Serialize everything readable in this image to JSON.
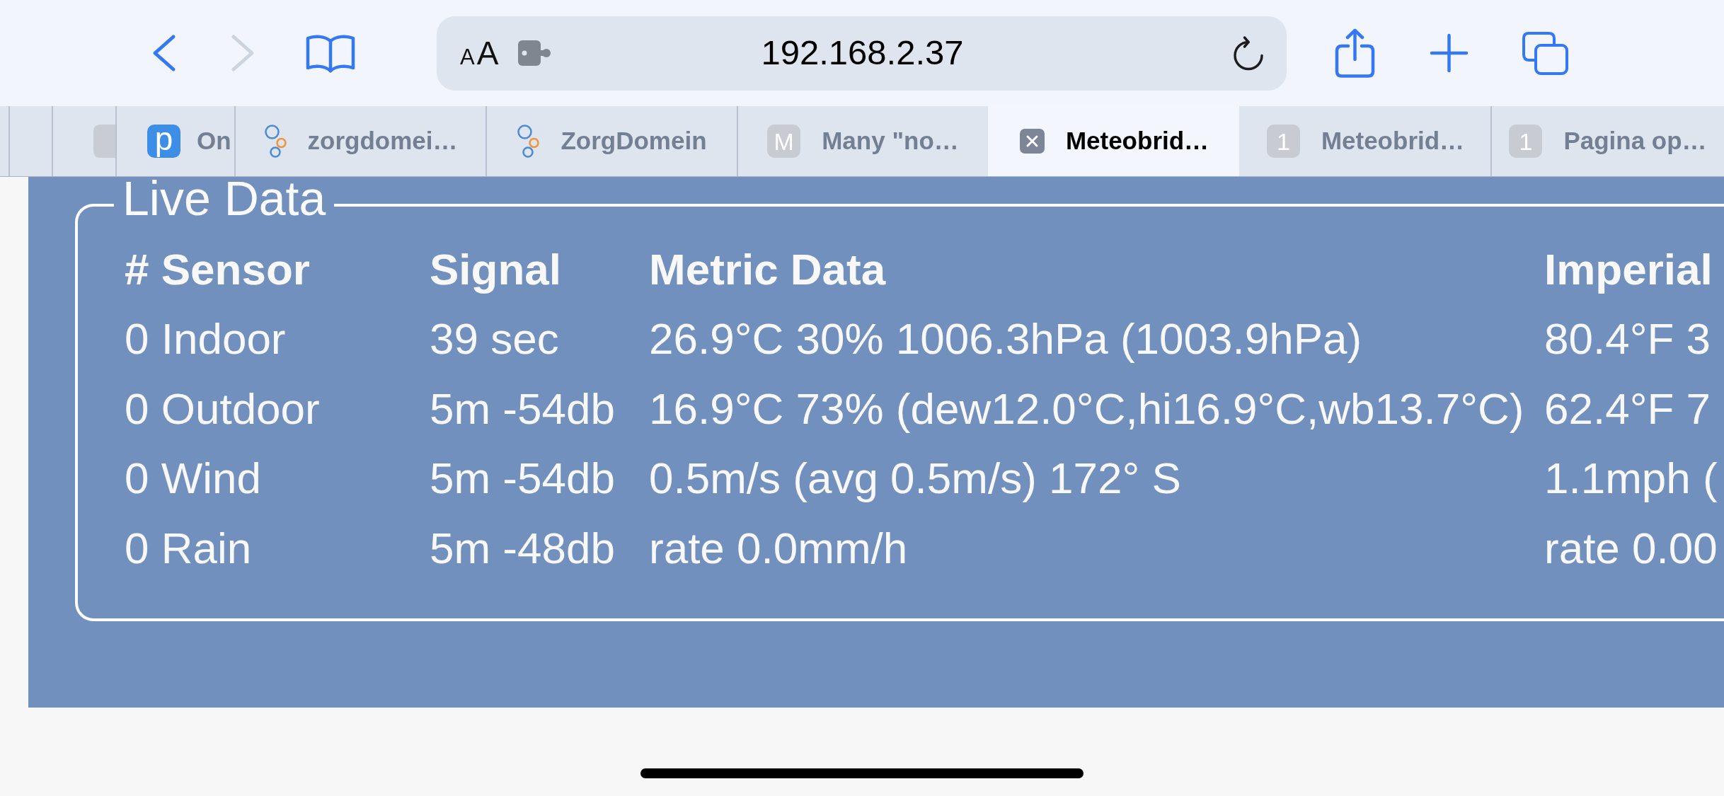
{
  "nav_buttons": [
    {
      "kind": "back",
      "disabled": false
    },
    {
      "kind": "forward",
      "disabled": true
    }
  ],
  "address_bar": {
    "text_size_button": {
      "small": "A",
      "large": "A"
    },
    "url": "192.168.2.37"
  },
  "tabs": [
    {
      "kind": "stacked",
      "selected": false
    },
    {
      "kind": "stub",
      "selected": false
    },
    {
      "kind": "app",
      "icon_text": "p",
      "label": "On",
      "selected": false
    },
    {
      "kind": "rings",
      "label": "zorgdomei…",
      "selected": false
    },
    {
      "kind": "rings",
      "label": "ZorgDomein",
      "selected": false
    },
    {
      "kind": "letter",
      "icon_text": "M",
      "label": "Many \"no…",
      "selected": false
    },
    {
      "kind": "close",
      "label": "Meteobrid…",
      "selected": true
    },
    {
      "kind": "letter",
      "icon_text": "1",
      "label": "Meteobrid…",
      "selected": false
    },
    {
      "kind": "letter",
      "icon_text": "1",
      "label": "Pagina op…",
      "selected": false
    }
  ],
  "live_data": {
    "title": "Live Data",
    "columns": [
      "# Sensor",
      "Signal",
      "Metric Data",
      "Imperial"
    ],
    "rows": [
      {
        "cells": [
          "0 Indoor",
          "39 sec",
          "26.9°C 30% 1006.3hPa (1003.9hPa)",
          "80.4°F 3"
        ]
      },
      {
        "cells": [
          "0 Outdoor",
          "5m -54db",
          "16.9°C 73% (dew12.0°C,hi16.9°C,wb13.7°C)",
          "62.4°F 7"
        ]
      },
      {
        "cells": [
          "0 Wind",
          "5m -54db",
          "0.5m/s (avg 0.5m/s) 172° S",
          "1.1mph ("
        ]
      },
      {
        "cells": [
          "0 Rain",
          "5m -48db",
          "rate 0.0mm/h",
          "rate 0.00"
        ]
      }
    ]
  }
}
